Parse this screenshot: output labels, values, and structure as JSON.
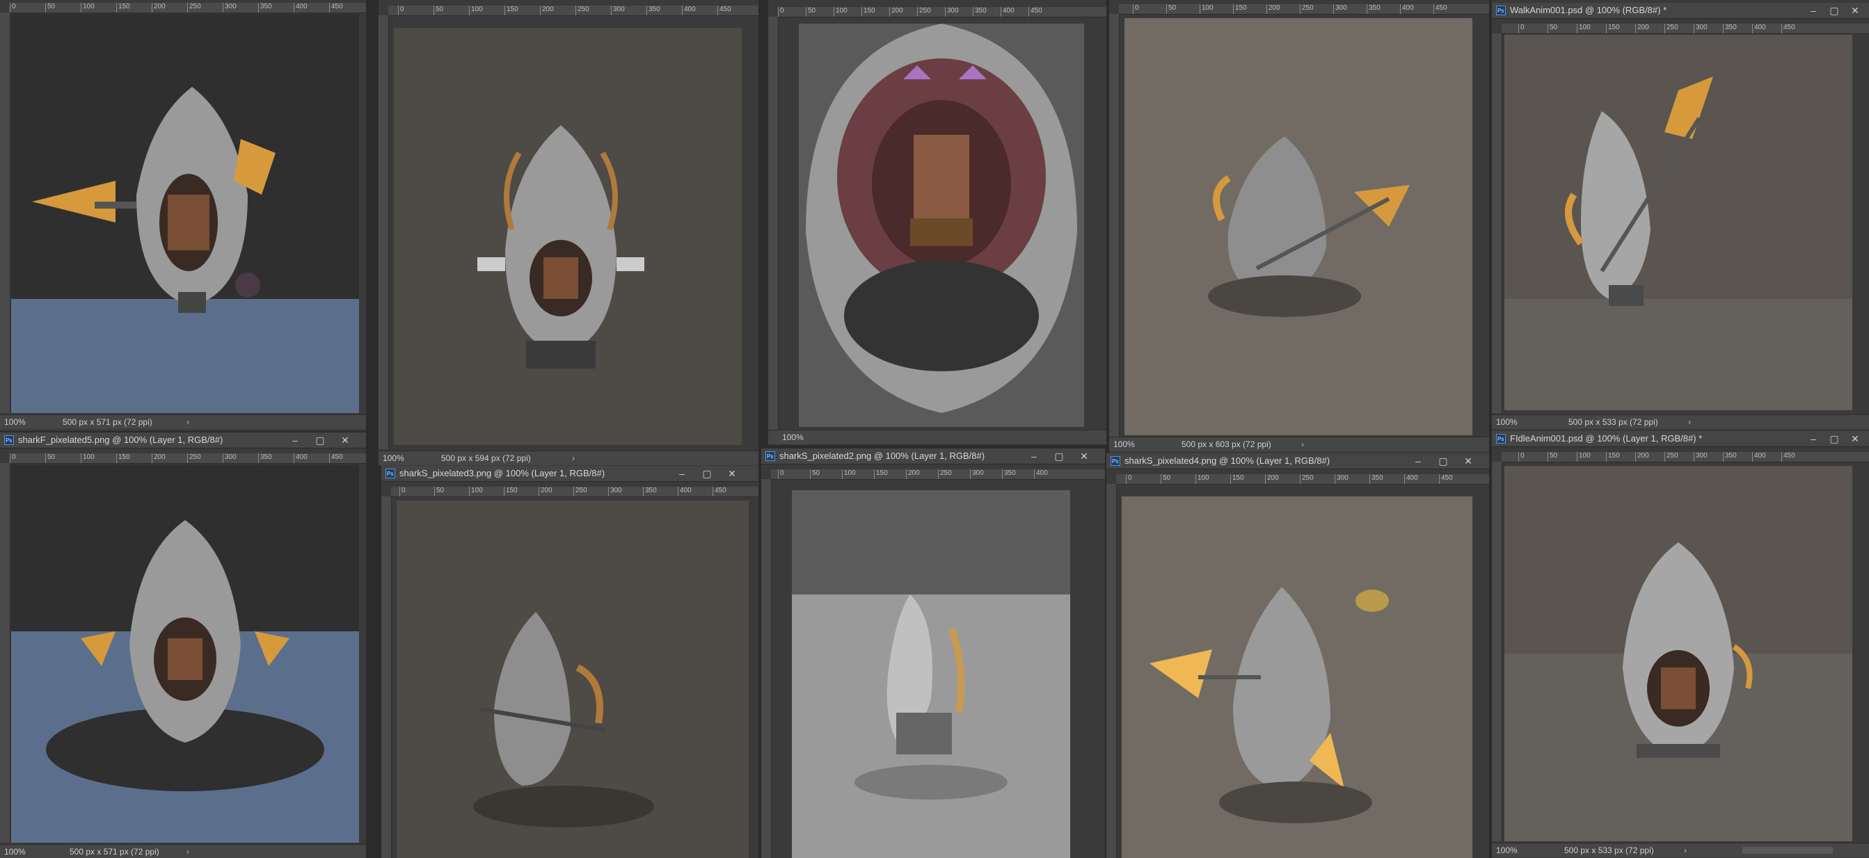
{
  "windows": [
    {
      "id": "w1",
      "title": "",
      "zoom": "100%",
      "dims": "500 px x 571 px (72 ppi)"
    },
    {
      "id": "w2",
      "title": "",
      "zoom": "100%",
      "dims": "500 px x 594 px (72 ppi)"
    },
    {
      "id": "w3",
      "title": "",
      "zoom": "100%",
      "dims": ""
    },
    {
      "id": "w4",
      "title": "",
      "zoom": "100%",
      "dims": "500 px x 603 px (72 ppi)"
    },
    {
      "id": "w5",
      "title": "WalkAnim001.psd @ 100% (RGB/8#) *",
      "zoom": "100%",
      "dims": "500 px x 533 px (72 ppi)"
    },
    {
      "id": "w6",
      "title": "sharkF_pixelated5.png @ 100% (Layer 1, RGB/8#)",
      "zoom": "100%",
      "dims": "500 px x 571 px (72 ppi)"
    },
    {
      "id": "w7",
      "title": "sharkS_pixelated3.png @ 100% (Layer 1, RGB/8#)",
      "zoom": "",
      "dims": ""
    },
    {
      "id": "w8",
      "title": "sharkS_pixelated2.png @ 100% (Layer 1, RGB/8#)",
      "zoom": "",
      "dims": ""
    },
    {
      "id": "w9",
      "title": "sharkS_pixelated4.png @ 100% (Layer 1, RGB/8#)",
      "zoom": "",
      "dims": ""
    },
    {
      "id": "w10",
      "title": "FIdleAnim001.psd @ 100% (Layer 1, RGB/8#) *",
      "zoom": "100%",
      "dims": "500 px x 533 px (72 ppi)"
    }
  ],
  "ruler_ticks": [
    "0",
    "50",
    "100",
    "150",
    "200",
    "250",
    "300",
    "350",
    "400",
    "450"
  ],
  "icons": {
    "minimize": "minimize-icon",
    "maximize": "maximize-icon",
    "close": "close-icon",
    "app": "photoshop-document-icon"
  },
  "colors": {
    "chrome": "#3a3a3a",
    "ruler": "#4a4a4a",
    "shark_gray": "#9a9a9a",
    "shark_dark": "#6c6c6c",
    "gold": "#d69a3c",
    "bg_dark": "#2f2f2f",
    "bg_taupe": "#5a5550",
    "bg_tan": "#716b64",
    "floor_blue": "#5b6f8c"
  }
}
